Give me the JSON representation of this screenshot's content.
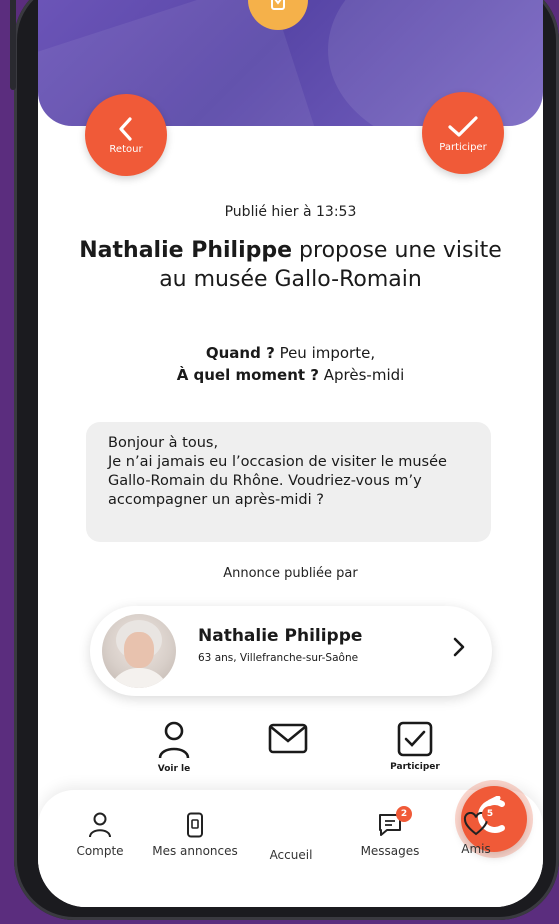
{
  "header": {
    "back_label": "Retour",
    "join_label": "Participer"
  },
  "post": {
    "published": "Publié hier à 13:53",
    "author_name": "Nathalie Philippe",
    "title_rest": "propose une visite au musée Gallo-Romain",
    "when_label": "Quand ?",
    "when_value": "Peu importe,",
    "moment_label": "À quel moment ?",
    "moment_value": "Après-midi",
    "message_line1": "Bonjour à tous,",
    "message_line2": "Je n’ai jamais eu l’occasion de visiter le musée Gallo-Romain du Rhône. Voudriez-vous m’y accompagner un après-midi ?",
    "posted_by": "Annonce publiée par"
  },
  "profile": {
    "name": "Nathalie Philippe",
    "info": "63 ans, Villefranche-sur-Saône"
  },
  "actions": [
    {
      "label": "Voir le",
      "icon": "user-icon"
    },
    {
      "label": "",
      "icon": "envelope-icon"
    },
    {
      "label": "Participer",
      "icon": "checkbox-icon"
    }
  ],
  "nav": {
    "items": [
      {
        "label": "Compte",
        "icon": "user-icon"
      },
      {
        "label": "Mes annonces",
        "icon": "phone-icon"
      },
      {
        "label": "Accueil",
        "icon": "home-logo-icon"
      },
      {
        "label": "Messages",
        "icon": "chat-icon",
        "badge": "2"
      },
      {
        "label": "Amis",
        "icon": "heart-icon",
        "badge": "5"
      }
    ]
  },
  "colors": {
    "accent": "#f05a38",
    "hero": "#5c48a8",
    "background": "#5b2d7e",
    "badge_yellow": "#f5b14a"
  }
}
